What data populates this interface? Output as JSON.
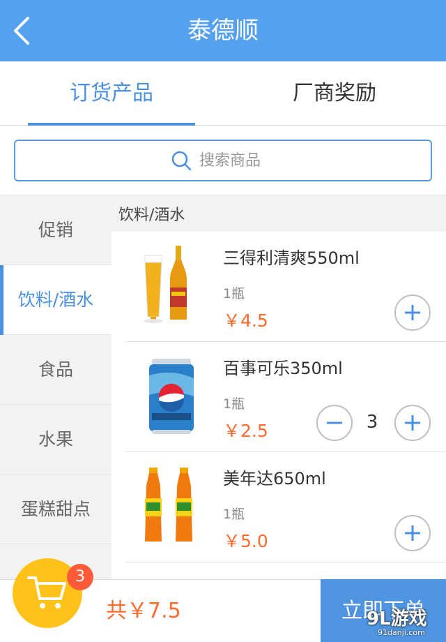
{
  "header": {
    "title": "泰德顺"
  },
  "tabs": [
    {
      "label": "订货产品",
      "active": true
    },
    {
      "label": "厂商奖励",
      "active": false
    }
  ],
  "search": {
    "placeholder": "搜索商品"
  },
  "sidebar": {
    "items": [
      {
        "label": "促销"
      },
      {
        "label": "饮料/酒水",
        "active": true
      },
      {
        "label": "食品"
      },
      {
        "label": "水果"
      },
      {
        "label": "蛋糕甜点"
      }
    ]
  },
  "category": {
    "title": "饮料/酒水"
  },
  "products": [
    {
      "name": "三得利清爽550ml",
      "unit": "1瓶",
      "price": "￥4.5",
      "quantity": null,
      "image": "beer-bottle-glass-icon"
    },
    {
      "name": "百事可乐350ml",
      "unit": "1瓶",
      "price": "￥2.5",
      "quantity": "3",
      "image": "pepsi-can-icon"
    },
    {
      "name": "美年达650ml",
      "unit": "1瓶",
      "price": "￥5.0",
      "quantity": null,
      "image": "mirinda-bottles-icon"
    }
  ],
  "cart": {
    "badge": "3",
    "total": "共￥7.5"
  },
  "submit": {
    "label": "立即下单"
  },
  "watermark": {
    "logo": "9L游戏",
    "url": "91danji.com"
  },
  "colors": {
    "primary": "#55a1ee",
    "accent_price": "#ff6b2c",
    "cart": "#ffc21a",
    "badge": "#ff5a3a"
  }
}
